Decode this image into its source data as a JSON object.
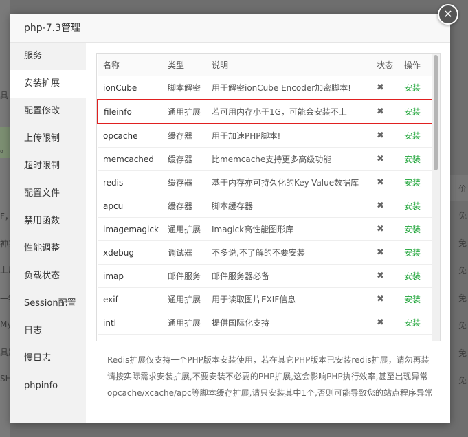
{
  "dialog": {
    "title": "php-7.3管理",
    "close_symbol": "✕"
  },
  "sidebar": {
    "items": [
      {
        "label": "服务"
      },
      {
        "label": "安装扩展"
      },
      {
        "label": "配置修改"
      },
      {
        "label": "上传限制"
      },
      {
        "label": "超时限制"
      },
      {
        "label": "配置文件"
      },
      {
        "label": "禁用函数"
      },
      {
        "label": "性能调整"
      },
      {
        "label": "负载状态"
      },
      {
        "label": "Session配置"
      },
      {
        "label": "日志"
      },
      {
        "label": "慢日志"
      },
      {
        "label": "phpinfo"
      }
    ],
    "active": "安装扩展"
  },
  "table": {
    "headers": [
      "名称",
      "类型",
      "说明",
      "状态",
      "操作"
    ],
    "rows": [
      {
        "name": "ionCube",
        "type": "脚本解密",
        "desc": "用于解密ionCube Encoder加密脚本!",
        "status": "✖",
        "action": "安装"
      },
      {
        "name": "fileinfo",
        "type": "通用扩展",
        "desc": "若可用内存小于1G，可能会安装不上",
        "status": "✖",
        "action": "安装"
      },
      {
        "name": "opcache",
        "type": "缓存器",
        "desc": "用于加速PHP脚本!",
        "status": "✖",
        "action": "安装"
      },
      {
        "name": "memcached",
        "type": "缓存器",
        "desc": "比memcache支持更多高级功能",
        "status": "✖",
        "action": "安装"
      },
      {
        "name": "redis",
        "type": "缓存器",
        "desc": "基于内存亦可持久化的Key-Value数据库",
        "status": "✖",
        "action": "安装"
      },
      {
        "name": "apcu",
        "type": "缓存器",
        "desc": "脚本缓存器",
        "status": "✖",
        "action": "安装"
      },
      {
        "name": "imagemagick",
        "type": "通用扩展",
        "desc": "Imagick高性能图形库",
        "status": "✖",
        "action": "安装"
      },
      {
        "name": "xdebug",
        "type": "调试器",
        "desc": "不多说,不了解的不要安装",
        "status": "✖",
        "action": "安装"
      },
      {
        "name": "imap",
        "type": "邮件服务",
        "desc": "邮件服务器必备",
        "status": "✖",
        "action": "安装"
      },
      {
        "name": "exif",
        "type": "通用扩展",
        "desc": "用于读取图片EXIF信息",
        "status": "✖",
        "action": "安装"
      },
      {
        "name": "intl",
        "type": "通用扩展",
        "desc": "提供国际化支持",
        "status": "✖",
        "action": "安装"
      }
    ],
    "highlighted_row": "fileinfo"
  },
  "notes": [
    "Redis扩展仅支持一个PHP版本安装使用，若在其它PHP版本已安装redis扩展，请勿再装",
    "请按实际需求安装扩展,不要安装不必要的PHP扩展,这会影响PHP执行效率,甚至出现异常",
    "opcache/xcache/apc等脚本缓存扩展,请只安装其中1个,否则可能导致您的站点程序异常"
  ],
  "background": {
    "left_fragments": [
      "具",
      "F，",
      "。",
      "神封",
      "上層",
      "一键",
      "My",
      "具题",
      "SH"
    ],
    "right_header": "价",
    "right_cells": [
      "免",
      "免",
      "免",
      "免",
      "免",
      "免",
      "免"
    ]
  },
  "colors": {
    "accent_green": "#20a53a",
    "highlight_red": "#e02020",
    "overlay": "#6e6e6e"
  }
}
